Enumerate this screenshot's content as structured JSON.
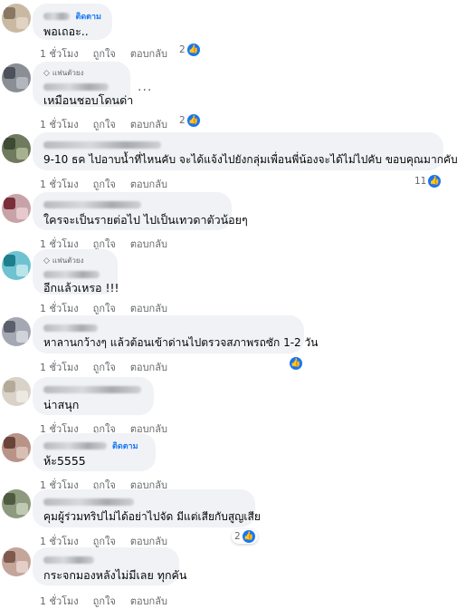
{
  "actions": {
    "time": "1 ชั่วโมง",
    "like": "ถูกใจ",
    "reply": "ตอบกลับ"
  },
  "badges": {
    "follow": "ติดตาม",
    "fan": "แฟนตัวยง"
  },
  "comments": [
    {
      "text": "พอเถอะ..",
      "reactions": "2"
    },
    {
      "text": "เหมือนชอบโดนด่า",
      "reactions": "2",
      "more": "..."
    },
    {
      "text": "9-10 ธค ไปอาบน้ำที่ไหนคับ จะได้แจ้งไปยังกลุ่มเพื่อนพี่น้องจะได้ไม่ไปคับ ขอบคุณมากคับ",
      "reactions": "11"
    },
    {
      "text": "ใครจะเป็นรายต่อไป ไปเป็นเทวดาตัวน้อยๆ"
    },
    {
      "text": "อีกแล้วเหรอ !!!"
    },
    {
      "text": "หาลานกว้างๆ แล้วต้อนเข้าด่านไปตรวจสภาพรถซัก 1-2 วัน"
    },
    {
      "text": "น่าสนุก"
    },
    {
      "text": "ห้ะ5555"
    },
    {
      "text": "คุมผู้ร่วมทริปไม่ได้อย่าไปจัด มีแต่เสียกับสูญเสีย",
      "reactions": "2"
    },
    {
      "text": "กระจกมองหลังไม่มีเลย ทุกคัน"
    }
  ],
  "colors": {
    "accent": "#1877f2",
    "bubble": "#f0f2f5",
    "meta": "#65676b"
  },
  "icons": {
    "like": "thumbs-up-icon",
    "fan": "diamond-icon"
  }
}
